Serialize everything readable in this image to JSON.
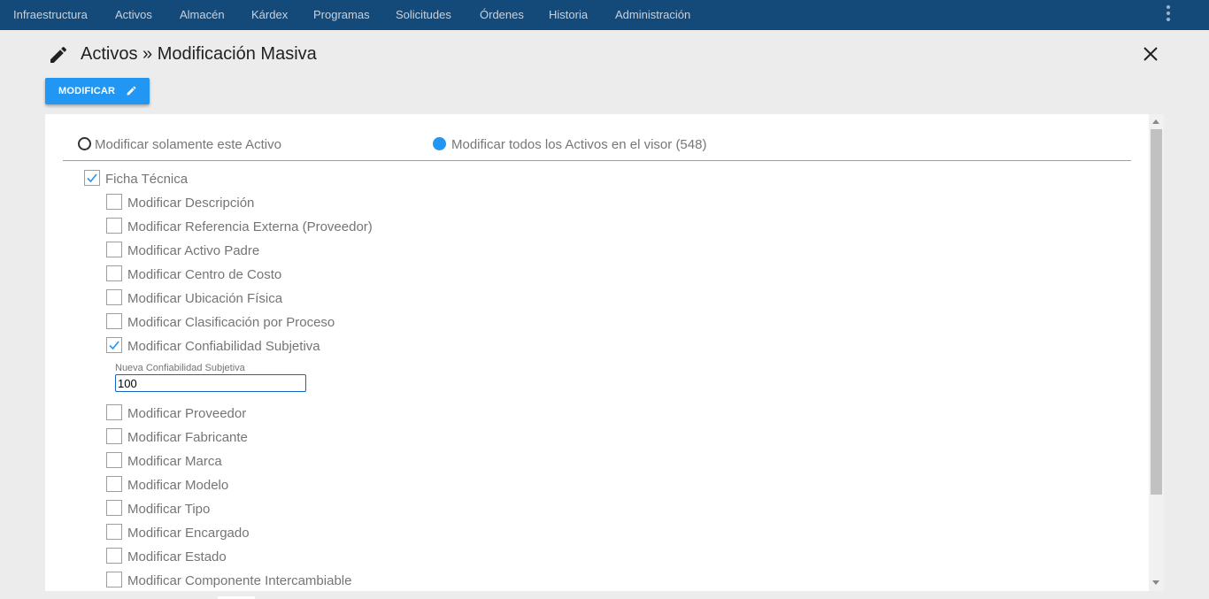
{
  "nav": {
    "items": [
      "Infraestructura",
      "Activos",
      "Almacén",
      "Kárdex",
      "Programas",
      "Solicitudes",
      "Órdenes",
      "Historia",
      "Administración"
    ],
    "menu_icon": "more-vert-icon"
  },
  "header": {
    "title": "Activos » Modificación Masiva",
    "title_icon": "pencil-icon",
    "close_icon": "close-icon"
  },
  "toolbar": {
    "modify_label": "MODIFICAR",
    "modify_icon": "pencil-icon",
    "modify_color": "#2196f3"
  },
  "scope": {
    "option_single": "Modificar solamente este Activo",
    "option_all": "Modificar todos los Activos en el visor (548)",
    "selected": "all"
  },
  "group": {
    "label": "Ficha Técnica",
    "checked": true
  },
  "options": [
    {
      "label": "Modificar Descripción",
      "checked": false
    },
    {
      "label": "Modificar Referencia Externa (Proveedor)",
      "checked": false
    },
    {
      "label": "Modificar Activo Padre",
      "checked": false
    },
    {
      "label": "Modificar Centro de Costo",
      "checked": false
    },
    {
      "label": "Modificar Ubicación Física",
      "checked": false
    },
    {
      "label": "Modificar Clasificación por Proceso",
      "checked": false
    },
    {
      "label": "Modificar Confiabilidad Subjetiva",
      "checked": true
    },
    {
      "label": "Modificar Proveedor",
      "checked": false
    },
    {
      "label": "Modificar Fabricante",
      "checked": false
    },
    {
      "label": "Modificar Marca",
      "checked": false
    },
    {
      "label": "Modificar Modelo",
      "checked": false
    },
    {
      "label": "Modificar Tipo",
      "checked": false
    },
    {
      "label": "Modificar Encargado",
      "checked": false
    },
    {
      "label": "Modificar Estado",
      "checked": false
    },
    {
      "label": "Modificar Componente Intercambiable",
      "checked": false
    }
  ],
  "confiabilidad_field": {
    "label": "Nueva Confiabilidad Subjetiva",
    "value": "100"
  },
  "colors": {
    "nav_bg": "#144a7a",
    "accent": "#2196f3",
    "check": "#2196f3"
  }
}
